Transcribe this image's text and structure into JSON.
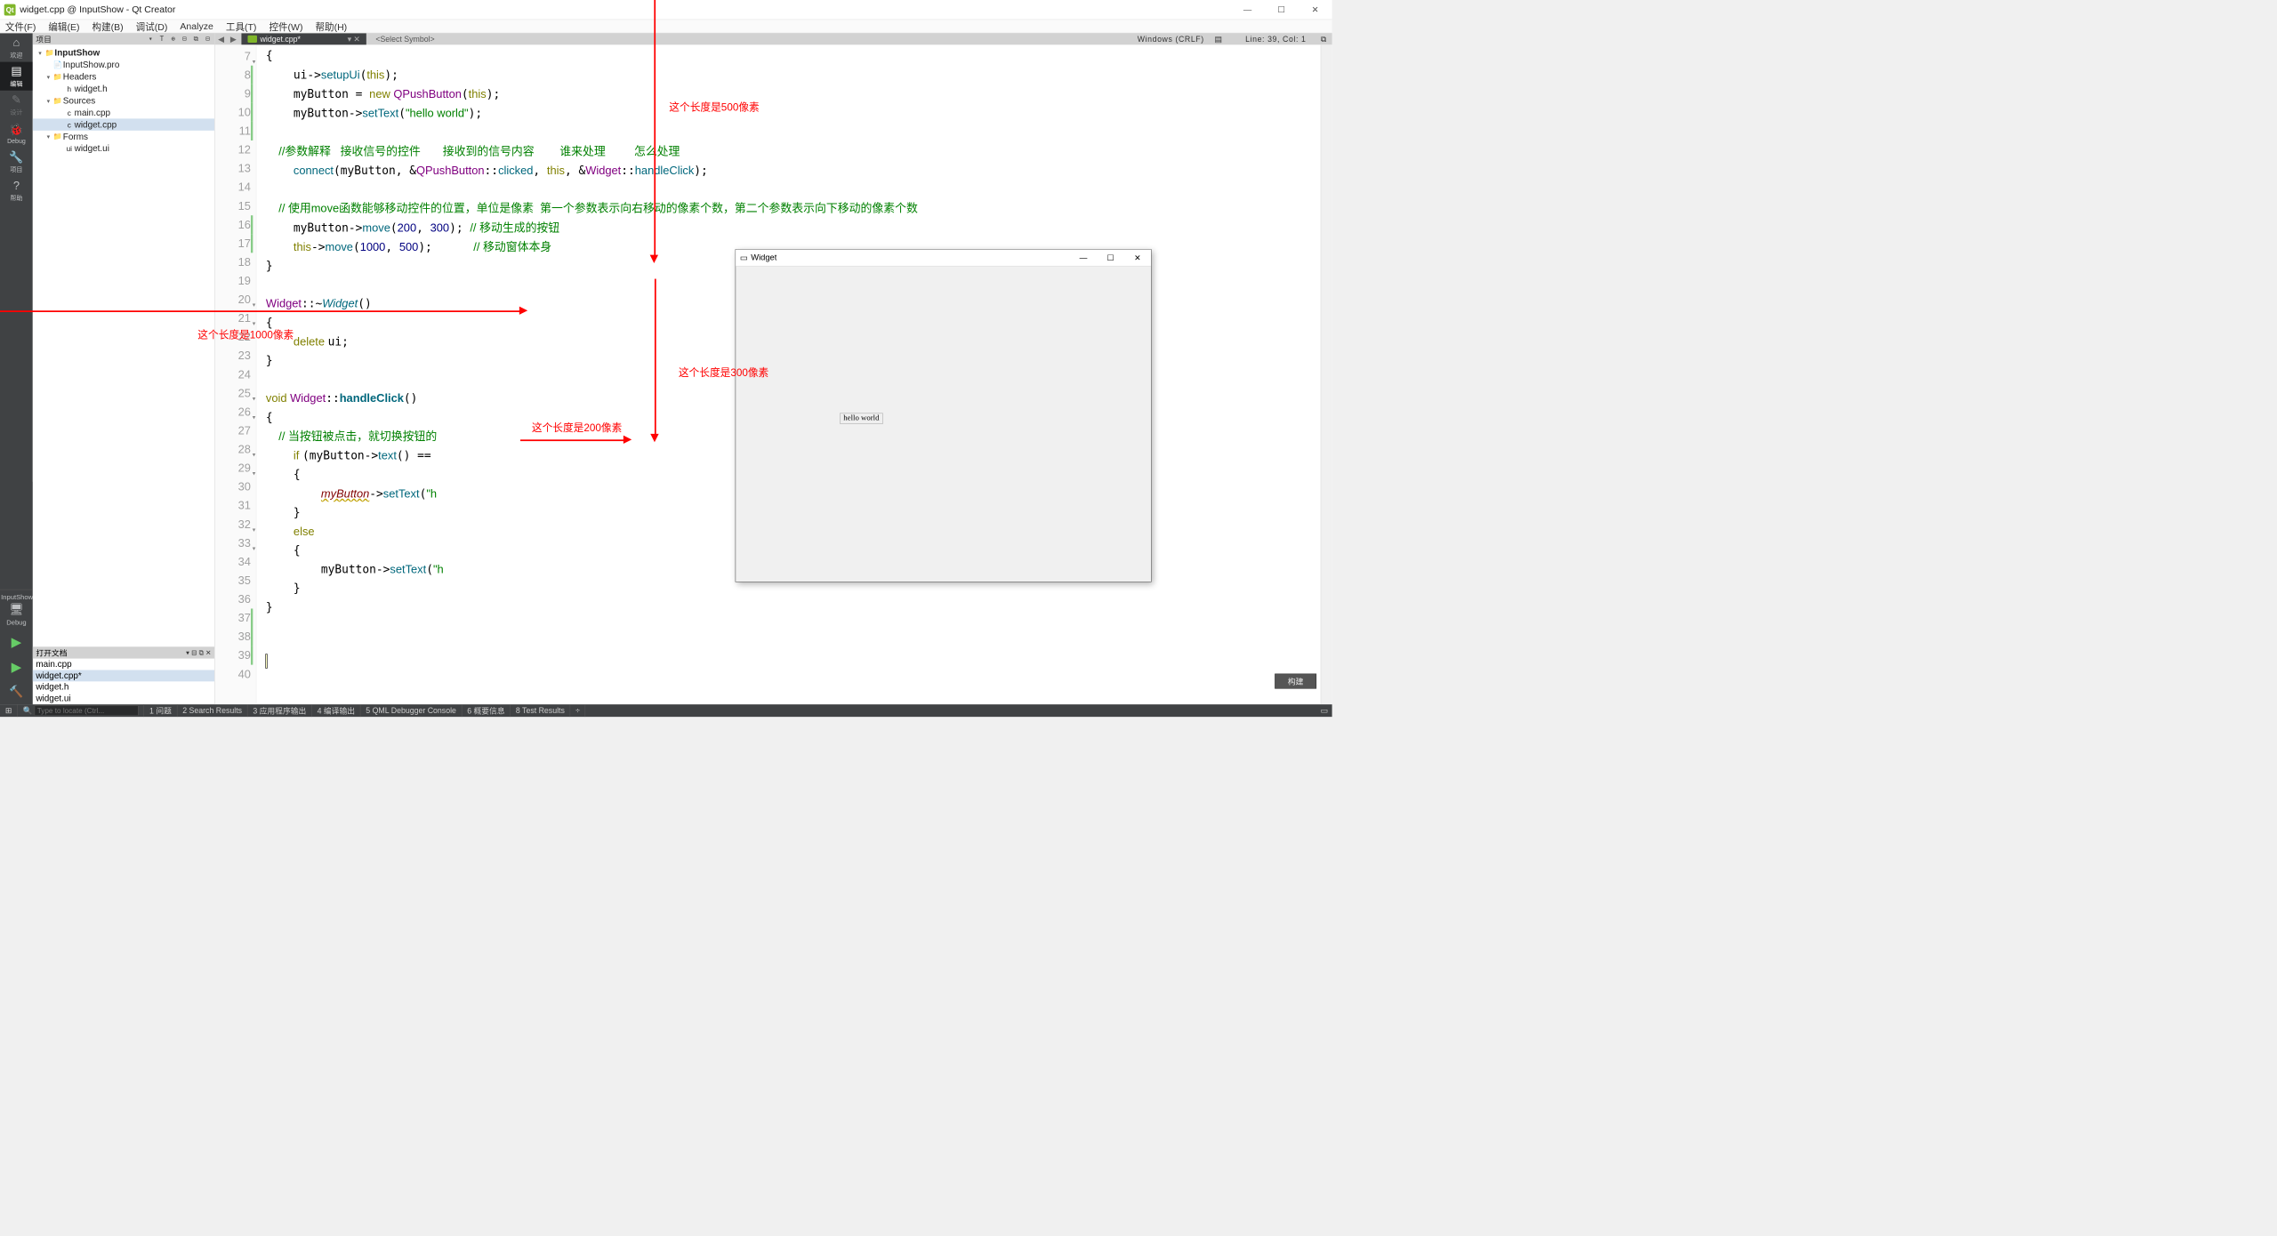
{
  "window": {
    "title": "widget.cpp @ InputShow - Qt Creator"
  },
  "menu": [
    "文件(F)",
    "编辑(E)",
    "构建(B)",
    "调试(D)",
    "Analyze",
    "工具(T)",
    "控件(W)",
    "帮助(H)"
  ],
  "modes": [
    {
      "label": "欢迎",
      "glyph": "⌂"
    },
    {
      "label": "编辑",
      "glyph": "▤",
      "sel": true
    },
    {
      "label": "设计",
      "glyph": "✎",
      "dim": true
    },
    {
      "label": "Debug",
      "glyph": "🐞"
    },
    {
      "label": "项目",
      "glyph": "🔧"
    },
    {
      "label": "帮助",
      "glyph": "?"
    }
  ],
  "kit": "InputShow",
  "kit2": "Debug",
  "project_header": "项目",
  "tree": [
    {
      "d": 0,
      "caret": "▾",
      "ico": "📁",
      "name": "InputShow",
      "bold": true
    },
    {
      "d": 1,
      "caret": "",
      "ico": "📄",
      "name": "InputShow.pro"
    },
    {
      "d": 1,
      "caret": "▾",
      "ico": "📁",
      "name": "Headers"
    },
    {
      "d": 2,
      "caret": "",
      "ico": "h",
      "name": "widget.h"
    },
    {
      "d": 1,
      "caret": "▾",
      "ico": "📁",
      "name": "Sources"
    },
    {
      "d": 2,
      "caret": "",
      "ico": "c",
      "name": "main.cpp"
    },
    {
      "d": 2,
      "caret": "",
      "ico": "c",
      "name": "widget.cpp",
      "sel": true
    },
    {
      "d": 1,
      "caret": "▾",
      "ico": "📁",
      "name": "Forms"
    },
    {
      "d": 2,
      "caret": "",
      "ico": "ui",
      "name": "widget.ui"
    }
  ],
  "open_files_hdr": "打开文档",
  "open_files": [
    {
      "name": "main.cpp"
    },
    {
      "name": "widget.cpp*",
      "sel": true
    },
    {
      "name": "widget.h"
    },
    {
      "name": "widget.ui"
    }
  ],
  "tab": {
    "name": "widget.cpp*",
    "symbol": "<Select Symbol>"
  },
  "status": {
    "enc": "Windows (CRLF)",
    "pos": "Line: 39, Col: 1"
  },
  "lines": [
    7,
    8,
    9,
    10,
    11,
    12,
    13,
    14,
    15,
    16,
    17,
    18,
    19,
    20,
    21,
    22,
    23,
    24,
    25,
    26,
    27,
    28,
    29,
    30,
    31,
    32,
    33,
    34,
    35,
    36,
    37,
    38,
    39,
    40
  ],
  "code": {
    "l7": "{",
    "l8a": "    ui->",
    "l8b": "setupUi",
    "l8c": "(",
    "l8d": "this",
    "l8e": ");",
    "l9a": "    myButton = ",
    "l9b": "new ",
    "l9c": "QPushButton",
    "l9d": "(",
    "l9e": "this",
    "l9f": ");",
    "l10a": "    myButton->",
    "l10b": "setText",
    "l10c": "(",
    "l10d": "\"hello world\"",
    "l10e": ");",
    "l12": "    //参数解释   接收信号的控件       接收到的信号内容        谁来处理         怎么处理",
    "l13a": "    ",
    "l13b": "connect",
    "l13c": "(myButton, &",
    "l13d": "QPushButton",
    "l13e": "::",
    "l13f": "clicked",
    "l13g": ", ",
    "l13h": "this",
    "l13i": ", &",
    "l13j": "Widget",
    "l13k": "::",
    "l13l": "handleClick",
    "l13m": ");",
    "l15": "    // 使用move函数能够移动控件的位置，单位是像素  第一个参数表示向右移动的像素个数，第二个参数表示向下移动的像素个数",
    "l16a": "    myButton->",
    "l16b": "move",
    "l16c": "(",
    "l16d": "200",
    "l16e": ", ",
    "l16f": "300",
    "l16g": "); ",
    "l16h": "// 移动生成的按钮",
    "l17a": "    ",
    "l17b": "this",
    "l17c": "->",
    "l17d": "move",
    "l17e": "(",
    "l17f": "1000",
    "l17g": ", ",
    "l17h": "500",
    "l17i": ");      ",
    "l17j": "// 移动窗体本身",
    "l18": "}",
    "l20a": "Widget",
    "l20b": "::~",
    "l20c": "Widget",
    "l20d": "()",
    "l21": "{",
    "l22a": "    ",
    "l22b": "delete ",
    "l22c": "ui;",
    "l23": "}",
    "l25a": "void ",
    "l25b": "Widget",
    "l25c": "::",
    "l25d": "handleClick",
    "l25e": "()",
    "l26": "{",
    "l27": "    // 当按钮被点击，就切换按钮的",
    "l28a": "    ",
    "l28b": "if ",
    "l28c": "(myButton->",
    "l28d": "text",
    "l28e": "() == ",
    "l29": "    {",
    "l30a": "        ",
    "l30b": "myButton",
    "l30c": "->",
    "l30d": "setText",
    "l30e": "(",
    "l30f": "\"h",
    "l31": "    }",
    "l32a": "    ",
    "l32b": "else",
    "l33": "    {",
    "l34a": "        myButton->",
    "l34b": "setText",
    "l34c": "(",
    "l34d": "\"h",
    "l35": "    }",
    "l36": "}"
  },
  "locator": {
    "placeholder": "Type to locate (Ctrl...",
    "items": [
      "1 问题",
      "2 Search Results",
      "3 应用程序输出",
      "4 编译输出",
      "5 QML Debugger Console",
      "6 概要信息",
      "8 Test Results"
    ]
  },
  "build_label": "构建",
  "widget": {
    "title": "Widget",
    "button": "hello world"
  },
  "anno": {
    "a500": "这个长度是500像素",
    "a300": "这个长度是300像素",
    "a200": "这个长度是200像素",
    "a1000": "这个长度是1000像素"
  }
}
